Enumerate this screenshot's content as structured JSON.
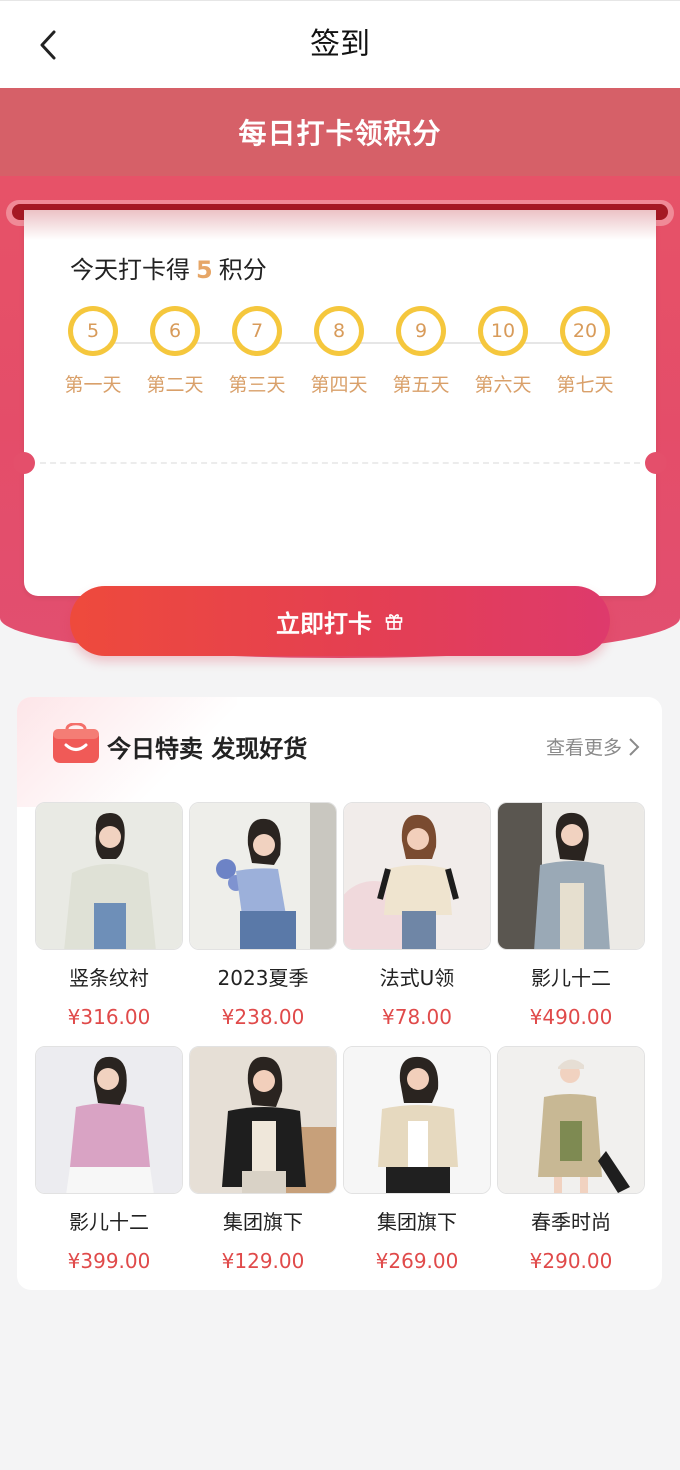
{
  "nav": {
    "title": "签到",
    "back_icon": "back-arrow-icon"
  },
  "hero": {
    "banner": "每日打卡领积分",
    "today_prefix": "今天打卡得",
    "today_points": "5",
    "today_suffix": "积分",
    "days": [
      {
        "points": "5",
        "label": "第一天"
      },
      {
        "points": "6",
        "label": "第二天"
      },
      {
        "points": "7",
        "label": "第三天"
      },
      {
        "points": "8",
        "label": "第四天"
      },
      {
        "points": "9",
        "label": "第五天"
      },
      {
        "points": "10",
        "label": "第六天"
      },
      {
        "points": "20",
        "label": "第七天"
      }
    ],
    "checkin_button": "立即打卡",
    "gift_icon": "gift-icon"
  },
  "deals": {
    "title": "今日特卖 发现好货",
    "more": "查看更多",
    "products": [
      {
        "name": "竖条纹衬",
        "price": "¥316.00"
      },
      {
        "name": "2023夏季",
        "price": "¥238.00"
      },
      {
        "name": "法式U领",
        "price": "¥78.00"
      },
      {
        "name": "影儿十二",
        "price": "¥490.00"
      },
      {
        "name": "影儿十二",
        "price": "¥399.00"
      },
      {
        "name": "集团旗下",
        "price": "¥129.00"
      },
      {
        "name": "集团旗下",
        "price": "¥269.00"
      },
      {
        "name": "春季时尚",
        "price": "¥290.00"
      }
    ]
  },
  "colors": {
    "accent": "#e44d69",
    "coin": "#f5c73d",
    "price": "#e04a4a",
    "label_gold": "#d9a06a"
  }
}
